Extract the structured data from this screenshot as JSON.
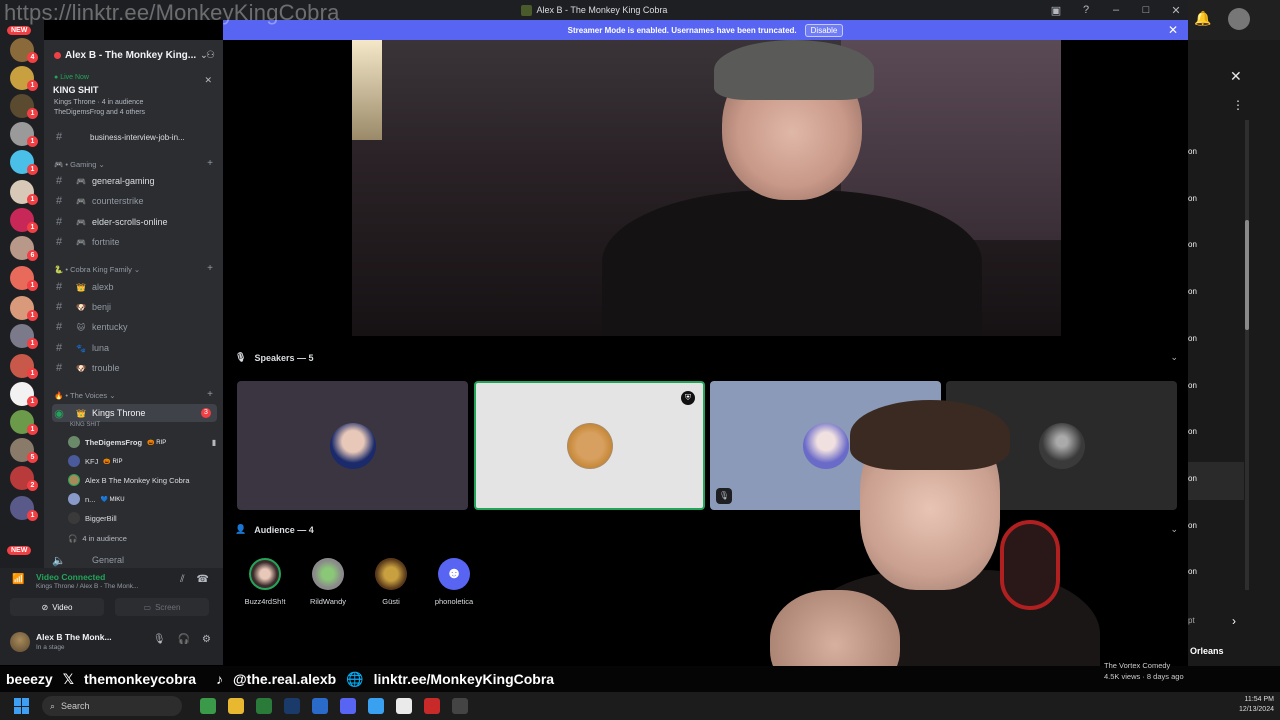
{
  "watermark": "https://linktr.ee/MonkeyKingCobra",
  "window": {
    "title": "Alex B - The Monkey King Cobra"
  },
  "banner": {
    "text": "Streamer Mode is enabled. Usernames have been truncated.",
    "button": "Disable"
  },
  "rail": {
    "new_label": "NEW",
    "badges": [
      "4",
      "1",
      "1",
      "1",
      "1",
      "1",
      "1",
      "6",
      "1",
      "1",
      "1",
      "1",
      "1",
      "1",
      "5",
      "2",
      "1",
      "1"
    ]
  },
  "server": {
    "name": "Alex B - The Monkey King..."
  },
  "live": {
    "label": "Live Now",
    "title": "KING SHIT",
    "meta1": "Kings Throne · 4 in audience",
    "meta2": "TheDigemsFrog and 4 others",
    "cut_channel": "business-interview-job-in..."
  },
  "categories": {
    "gaming": "Gaming",
    "family": "Cobra King Family",
    "voices": "The Voices"
  },
  "channels_gaming": [
    "general-gaming",
    "counterstrike",
    "elder-scrolls-online",
    "fortnite"
  ],
  "channels_family": [
    "alexb",
    "benji",
    "kentucky",
    "luna",
    "trouble"
  ],
  "stage": {
    "name": "Kings Throne",
    "sub": "KING SHIT",
    "unread": "3",
    "members": [
      {
        "name": "TheDigemsFrog",
        "tag": "RIP"
      },
      {
        "name": "KFJ",
        "tag": "RIP"
      },
      {
        "name": "Alex B The Monkey King Cobra",
        "tag": ""
      },
      {
        "name": "n...",
        "tag": "MIKU"
      },
      {
        "name": "BiggerBill",
        "tag": ""
      }
    ],
    "audience_count": "4 in audience",
    "next_channel": "General"
  },
  "voice_panel": {
    "status": "Video Connected",
    "sub": "Kings Throne / Alex B - The Monk...",
    "video_label": "Video",
    "screen_label": "Screen",
    "user_name": "Alex B The Monk...",
    "user_status": "In a stage"
  },
  "speakers": {
    "header": "Speakers — 5"
  },
  "audience": {
    "header": "Audience — 4",
    "people": [
      "Buzz4rdSh!t",
      "RildWandy",
      "Güsti",
      "phonoletica"
    ]
  },
  "right_panel": {
    "items": [
      "on",
      "on",
      "on",
      "on",
      "on",
      "on",
      "on",
      "on",
      "on",
      "on"
    ],
    "pt": "pt",
    "orleans": "Orleans",
    "meta_title": "The Vortex Comedy",
    "meta_stats": "4.5K views · 8 days ago"
  },
  "stream_bar": {
    "tw": "beeezy",
    "x": "themonkeycobra",
    "tt": "@the.real.alexb",
    "link": "linktr.ee/MonkeyKingCobra"
  },
  "taskbar": {
    "search": "Search",
    "time": "11:54 PM",
    "date": "12/13/2024"
  }
}
